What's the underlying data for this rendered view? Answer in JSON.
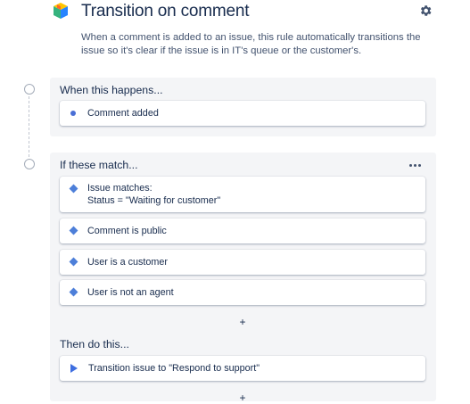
{
  "header": {
    "title": "Transition on comment",
    "description": "When a comment is added to an issue, this rule automatically transitions the issue so it's clear if the issue is in IT's queue or the customer's.",
    "settings_icon": "gear-icon",
    "logo_icon": "automation-cube-icon"
  },
  "trigger_section": {
    "title": "When this happens...",
    "items": [
      {
        "icon": "dot-icon",
        "label": "Comment added"
      }
    ]
  },
  "conditions_section": {
    "title": "If these match...",
    "more_icon": "more-icon",
    "items": [
      {
        "icon": "diamond-icon",
        "label": "Issue matches:",
        "detail": "Status = \"Waiting for customer\""
      },
      {
        "icon": "diamond-icon",
        "label": "Comment is public"
      },
      {
        "icon": "diamond-icon",
        "label": "User is a customer"
      },
      {
        "icon": "diamond-icon",
        "label": "User is not an agent"
      }
    ],
    "add_label": "+"
  },
  "actions_section": {
    "title": "Then do this...",
    "items": [
      {
        "icon": "play-icon",
        "label": "Transition issue to \"Respond to support\""
      }
    ],
    "add_label": "+"
  },
  "colors": {
    "section_bg": "#f4f5f7",
    "text": "#172b4d",
    "subtle_text": "#42526e",
    "icon_blue": "#4d7fd9"
  }
}
